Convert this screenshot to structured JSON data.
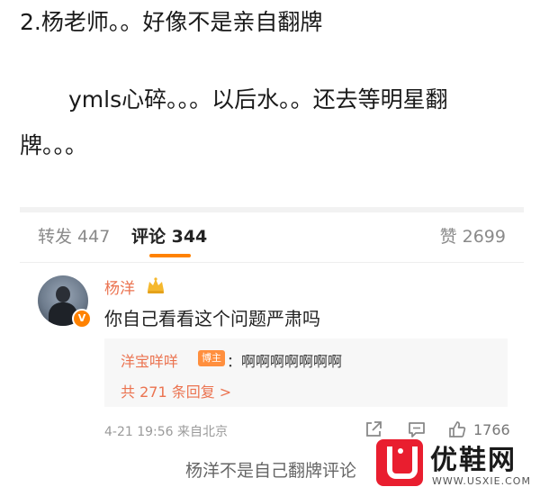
{
  "post": {
    "line1": "2.杨老师。。好像不是亲自翻牌",
    "line2": "ymls心碎。。。以后水。。还去等明星翻",
    "line3": "牌。。。"
  },
  "tabs": {
    "repost": "转发 447",
    "comment": "评论 344",
    "like": "赞 2699"
  },
  "comment": {
    "username": "杨洋",
    "text": "你自己看看这个问题严肃吗",
    "reply": {
      "author": "洋宝咩咩",
      "badge": "博主",
      "text": "：啊啊啊啊啊啊啊",
      "count": "共 271 条回复 >"
    },
    "meta": "4-21 19:56  来自北京",
    "like_count": "1766"
  },
  "caption": "杨洋不是自己翻牌评论",
  "watermark": {
    "title": "优鞋网",
    "url": "WWW.USXIE.COM"
  },
  "colors": {
    "accent_orange": "#ff8200",
    "username_orange": "#eb7350",
    "watermark_red": "#e91e2f"
  }
}
